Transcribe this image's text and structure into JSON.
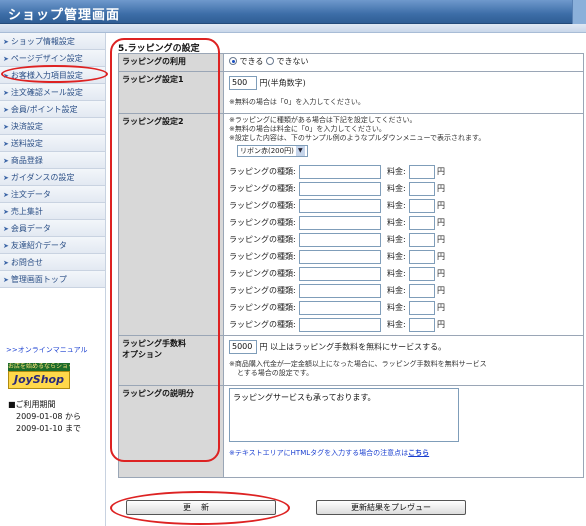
{
  "header": {
    "title": "ショップ管理画面"
  },
  "sidebar": {
    "items": [
      {
        "label": "ショップ情報設定"
      },
      {
        "label": "ページデザイン設定"
      },
      {
        "label": "お客様入力項目設定"
      },
      {
        "label": "注文確認メール設定"
      },
      {
        "label": "会員/ポイント設定"
      },
      {
        "label": "決済設定"
      },
      {
        "label": "送料設定"
      },
      {
        "label": "商品登録"
      },
      {
        "label": "ガイダンスの設定"
      },
      {
        "label": "注文データ"
      },
      {
        "label": "売上集計"
      },
      {
        "label": "会員データ"
      },
      {
        "label": "友達紹介データ"
      },
      {
        "label": "お問合せ"
      },
      {
        "label": "管理画面トップ"
      }
    ],
    "manual_link": ">>オンラインマニュアル",
    "logo": {
      "tagline": "お店を始めるならショップ",
      "name": "JoyShop"
    },
    "period": {
      "heading": "■ご利用期間",
      "from": "2009-01-08  から",
      "to": "2009-01-10  まで"
    }
  },
  "section": {
    "title": "5.ラッピングの設定"
  },
  "form": {
    "usage": {
      "label": "ラッピングの利用",
      "option_yes": "できる",
      "option_no": "できない"
    },
    "setting1": {
      "label": "ラッピング設定1",
      "value": "500",
      "unit": "円(半角数字)",
      "note": "※無料の場合は「0」を入力してください。"
    },
    "setting2": {
      "label": "ラッピング設定2",
      "notes": [
        "※ラッピングに種類がある場合は下記を設定してください。",
        "※無料の場合は料金に「0」を入力してください。",
        "※設定した内容は、下のサンプル例のようなプルダウンメニューで表示されます。"
      ],
      "sample_select": "リボン赤(200円)",
      "row_label": "ラッピングの種類:",
      "fee_label": "料金:",
      "yen": "円",
      "rows": [
        "",
        "",
        "",
        "",
        "",
        "",
        "",
        "",
        "",
        ""
      ]
    },
    "fee_option": {
      "label_line1": "ラッピング手数料",
      "label_line2": "オプション",
      "value": "5000",
      "text": "円 以上はラッピング手数料を無料にサービスする。",
      "note_line1": "※商品購入代金が一定金額以上になった場合に、ラッピング手数料を無料サービス",
      "note_line2": "とする場合の設定です。"
    },
    "description": {
      "label": "ラッピングの説明分",
      "value": "ラッピングサービスも承っております。",
      "note": "※テキストエリアにHTMLタグを入力する場合の注意点は",
      "note_link": "こちら"
    }
  },
  "buttons": {
    "update": "更新",
    "preview": "更新結果をプレヴュー"
  },
  "colors": {
    "header": "#3d6ea8",
    "label_bg": "#d8d8d8",
    "annotation": "#dd2222",
    "link": "#1a3fd0"
  }
}
